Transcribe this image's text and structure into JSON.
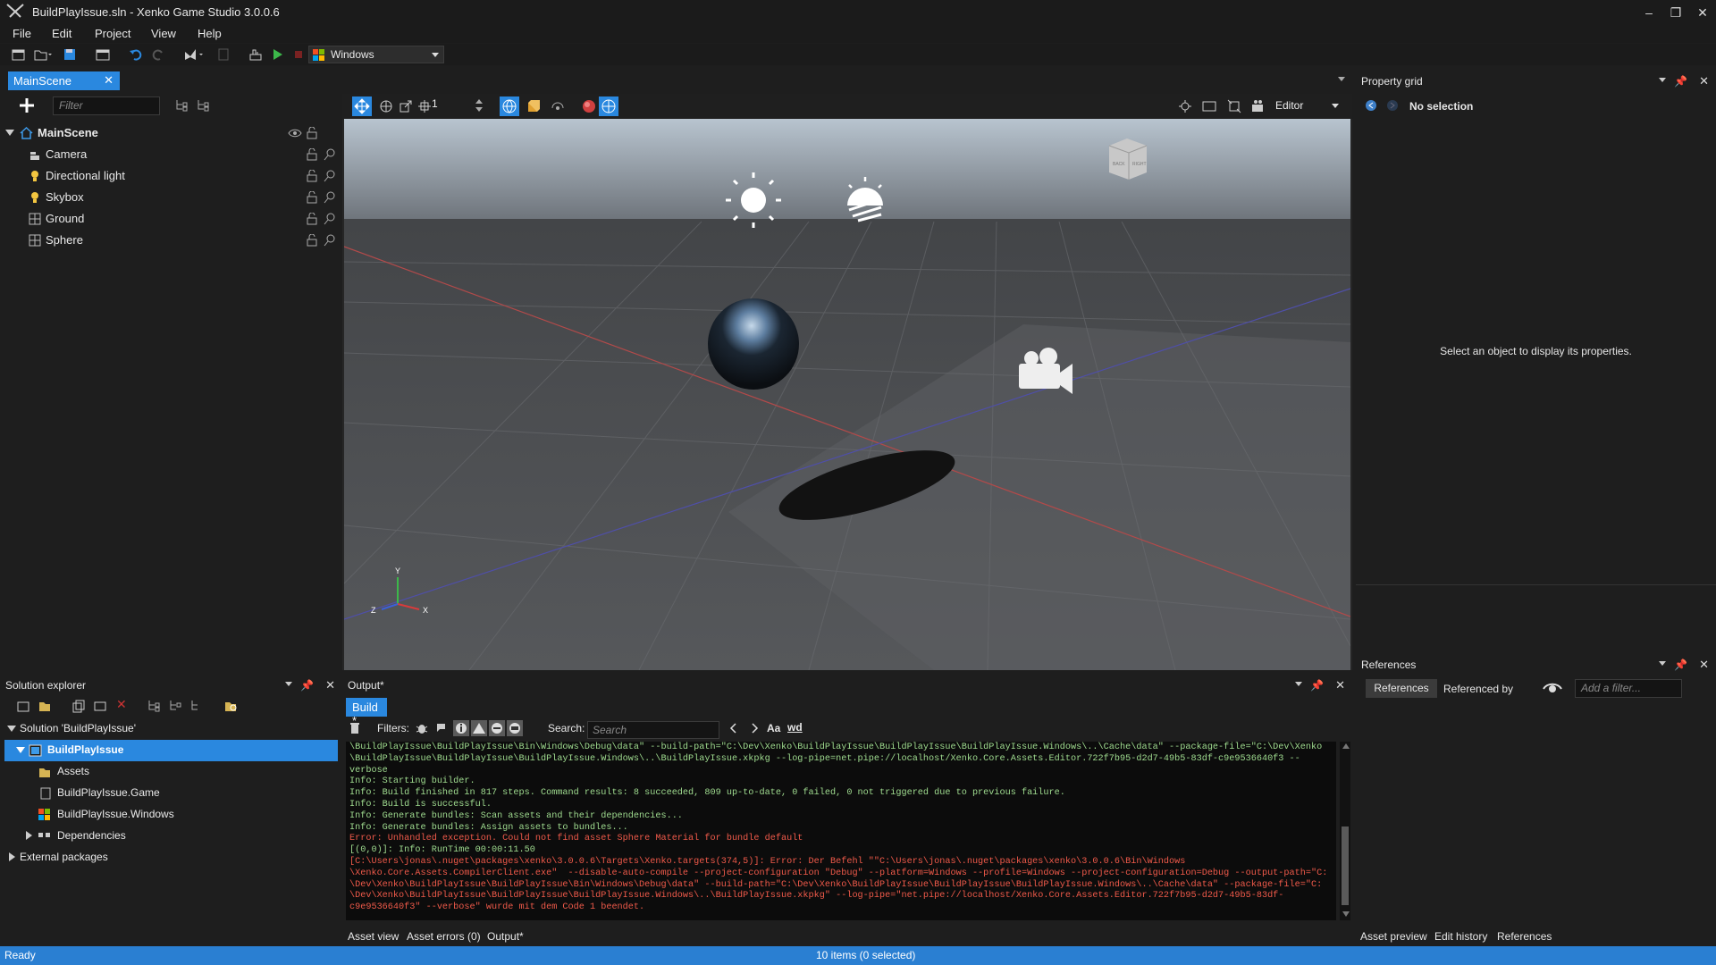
{
  "window": {
    "title": "BuildPlayIssue.sln - Xenko Game Studio 3.0.0.6",
    "minimize": "–",
    "restore": "❐",
    "close": "✕"
  },
  "menu": [
    "File",
    "Edit",
    "Project",
    "View",
    "Help"
  ],
  "toolbar": {
    "platform": "Windows"
  },
  "scene_tab": {
    "label": "MainScene",
    "close": "✕"
  },
  "hierarchy": {
    "filter_placeholder": "Filter",
    "root": "MainScene",
    "items": [
      "Camera",
      "Directional light",
      "Skybox",
      "Ground",
      "Sphere"
    ]
  },
  "viewport": {
    "zoom_value": "1",
    "mode": "Editor",
    "axis": {
      "y": "Y",
      "z": "Z",
      "x": "X"
    },
    "gizmo_cube": {
      "left": "BACK",
      "right": "RIGHT"
    }
  },
  "property_grid": {
    "title": "Property grid",
    "selection": "No selection",
    "empty_message": "Select an object to display its properties."
  },
  "references": {
    "title": "References",
    "tab_references": "References",
    "tab_referenced_by": "Referenced by",
    "filter_placeholder": "Add a filter..."
  },
  "solution_explorer": {
    "title": "Solution explorer",
    "solution": "Solution 'BuildPlayIssue'",
    "project": "BuildPlayIssue",
    "children": [
      "Assets",
      "BuildPlayIssue.Game",
      "BuildPlayIssue.Windows",
      "Dependencies"
    ],
    "external": "External packages"
  },
  "output": {
    "title": "Output*",
    "build_tab": "Build *",
    "filters_label": "Filters:",
    "search_label": "Search:",
    "search_placeholder": "Search",
    "case_label": "Aa",
    "word_label": "wd",
    "lines": [
      {
        "t": "i",
        "s": "\\BuildPlayIssue\\BuildPlayIssue\\Bin\\Windows\\Debug\\data\" --build-path=\"C:\\Dev\\Xenko\\BuildPlayIssue\\BuildPlayIssue\\BuildPlayIssue.Windows\\..\\Cache\\data\" --package-file=\"C:\\Dev\\Xenko"
      },
      {
        "t": "i",
        "s": "\\BuildPlayIssue\\BuildPlayIssue\\BuildPlayIssue.Windows\\..\\BuildPlayIssue.xkpkg --log-pipe=net.pipe://localhost/Xenko.Core.Assets.Editor.722f7b95-d2d7-49b5-83df-c9e9536640f3 --"
      },
      {
        "t": "i",
        "s": "verbose"
      },
      {
        "t": "i",
        "s": "Info: Starting builder."
      },
      {
        "t": "i",
        "s": "Info: Build finished in 817 steps. Command results: 8 succeeded, 809 up-to-date, 0 failed, 0 not triggered due to previous failure."
      },
      {
        "t": "i",
        "s": "Info: Build is successful."
      },
      {
        "t": "i",
        "s": "Info: Generate bundles: Scan assets and their dependencies..."
      },
      {
        "t": "i",
        "s": "Info: Generate bundles: Assign assets to bundles..."
      },
      {
        "t": "e",
        "s": "Error: Unhandled exception. Could not find asset Sphere Material for bundle default"
      },
      {
        "t": "i",
        "s": "[(0,0)]: Info: RunTime 00:00:11.50"
      },
      {
        "t": "e",
        "s": "[C:\\Users\\jonas\\.nuget\\packages\\xenko\\3.0.0.6\\Targets\\Xenko.targets(374,5)]: Error: Der Befehl \"\"C:\\Users\\jonas\\.nuget\\packages\\xenko\\3.0.0.6\\Bin\\Windows"
      },
      {
        "t": "e",
        "s": "\\Xenko.Core.Assets.CompilerClient.exe\"  --disable-auto-compile --project-configuration \"Debug\" --platform=Windows --profile=Windows --project-configuration=Debug --output-path=\"C:"
      },
      {
        "t": "e",
        "s": "\\Dev\\Xenko\\BuildPlayIssue\\BuildPlayIssue\\Bin\\Windows\\Debug\\data\" --build-path=\"C:\\Dev\\Xenko\\BuildPlayIssue\\BuildPlayIssue\\BuildPlayIssue.Windows\\..\\Cache\\data\" --package-file=\"C:"
      },
      {
        "t": "e",
        "s": "\\Dev\\Xenko\\BuildPlayIssue\\BuildPlayIssue\\BuildPlayIssue.Windows\\..\\BuildPlayIssue.xkpkg\" --log-pipe=\"net.pipe://localhost/Xenko.Core.Assets.Editor.722f7b95-d2d7-49b5-83df-"
      },
      {
        "t": "e",
        "s": "c9e9536640f3\" --verbose\" wurde mit dem Code 1 beendet."
      }
    ]
  },
  "bottom_tabs_left": [
    "Asset view",
    "Asset errors (0)",
    "Output*"
  ],
  "bottom_tabs_right": [
    "Asset preview",
    "Edit history",
    "References"
  ],
  "status": {
    "left": "Ready",
    "center": "10 items (0 selected)"
  },
  "colors": {
    "accent": "#2a88df",
    "status": "#2a7fd2",
    "info": "#9fdb8f",
    "error": "#f05a4a"
  }
}
